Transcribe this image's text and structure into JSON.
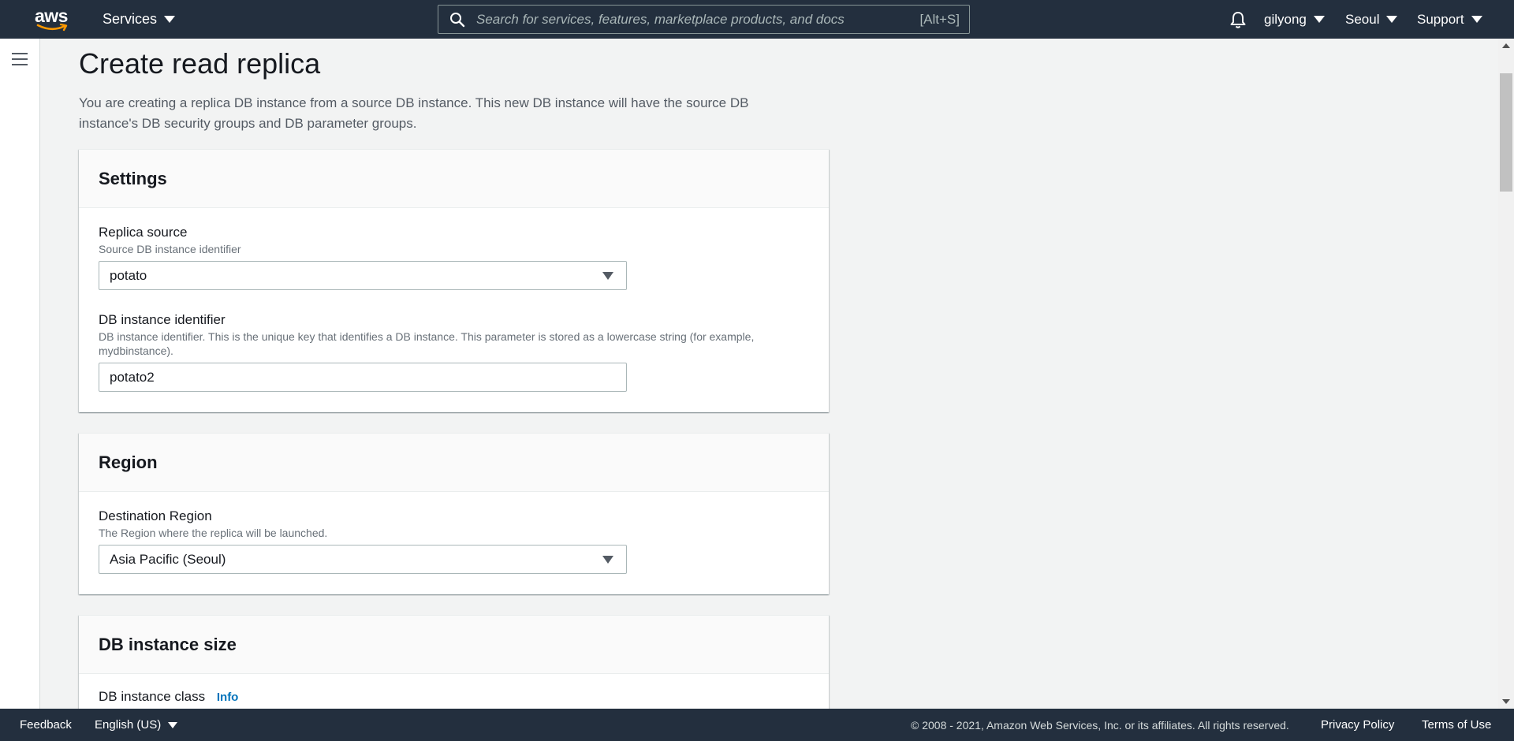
{
  "topnav": {
    "logo_text": "aws",
    "services_label": "Services",
    "search_placeholder": "Search for services, features, marketplace products, and docs",
    "search_shortcut": "[Alt+S]",
    "user_label": "gilyong",
    "region_label": "Seoul",
    "support_label": "Support"
  },
  "page": {
    "title": "Create read replica",
    "description": "You are creating a replica DB instance from a source DB instance. This new DB instance will have the source DB instance's DB security groups and DB parameter groups."
  },
  "settings": {
    "heading": "Settings",
    "replica_source": {
      "label": "Replica source",
      "description": "Source DB instance identifier",
      "value": "potato"
    },
    "db_instance_identifier": {
      "label": "DB instance identifier",
      "description": "DB instance identifier. This is the unique key that identifies a DB instance. This parameter is stored as a lowercase string (for example, mydbinstance).",
      "value": "potato2"
    }
  },
  "region": {
    "heading": "Region",
    "destination_region": {
      "label": "Destination Region",
      "description": "The Region where the replica will be launched.",
      "value": "Asia Pacific (Seoul)"
    }
  },
  "db_instance_size": {
    "heading": "DB instance size",
    "db_instance_class": {
      "label": "DB instance class",
      "info_label": "Info"
    }
  },
  "footer": {
    "feedback_label": "Feedback",
    "language_label": "English (US)",
    "copyright": "© 2008 - 2021, Amazon Web Services, Inc. or its affiliates. All rights reserved.",
    "privacy_label": "Privacy Policy",
    "terms_label": "Terms of Use"
  }
}
